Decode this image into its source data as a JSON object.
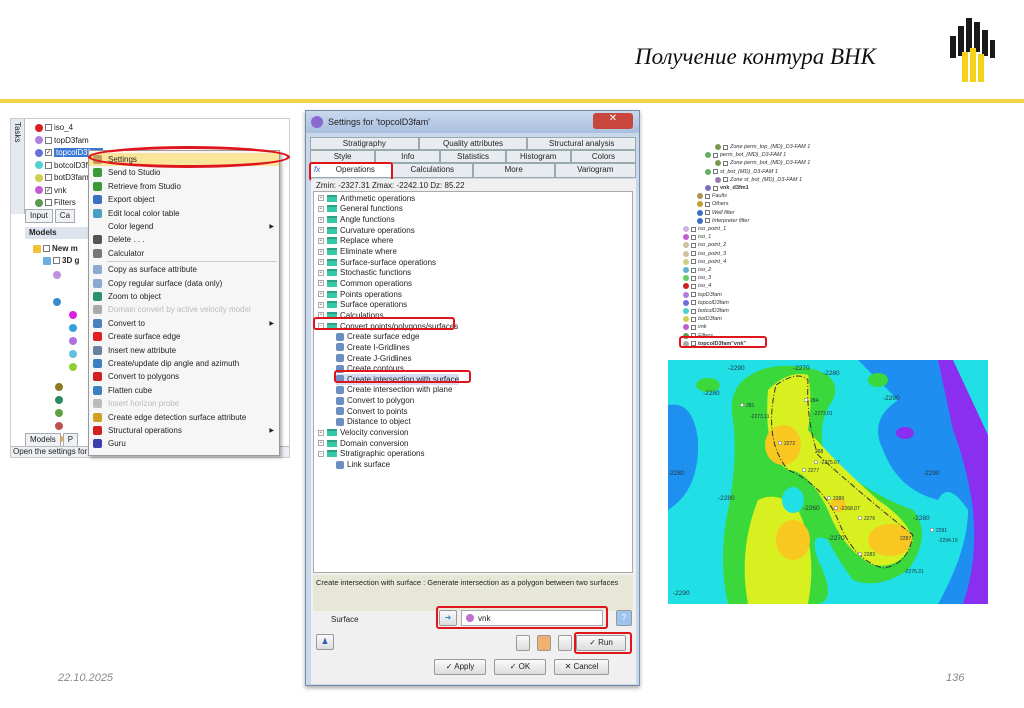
{
  "slide": {
    "title": "Получение контура ВНК",
    "date": "22.10.2025",
    "page": "136",
    "accent_color": "#f3d34a"
  },
  "left_panel": {
    "side_tabs": [
      "Tasks"
    ],
    "tree_top": [
      {
        "label": "iso_4",
        "checked": false
      },
      {
        "label": "topD3fam",
        "checked": false
      },
      {
        "label": "topcolD3fam",
        "checked": true,
        "selected": true
      },
      {
        "label": "botcolD3fam",
        "checked": false
      },
      {
        "label": "botD3fam",
        "checked": false
      },
      {
        "label": "vnk",
        "checked": true
      },
      {
        "label": "Filters",
        "checked": false
      }
    ],
    "tabs": [
      "Input",
      "Ca"
    ],
    "models_header": "Models",
    "tree_models": [
      "New m",
      "3D g"
    ],
    "bottom_tabs": [
      "Models",
      "P"
    ],
    "status": "Open the settings for t"
  },
  "context_menu": {
    "items": [
      {
        "label": "Settings",
        "highlighted": true
      },
      {
        "label": "Send to Studio"
      },
      {
        "label": "Retrieve from Studio"
      },
      {
        "label": "Export object"
      },
      {
        "label": "Edit local color table"
      },
      {
        "label": "Color legend",
        "submenu": true
      },
      {
        "label": "Delete . . ."
      },
      {
        "label": "Calculator"
      },
      {
        "label": "Copy as surface attribute"
      },
      {
        "label": "Copy regular surface (data only)"
      },
      {
        "label": "Zoom to object"
      },
      {
        "label": "Domain convert by active velocity model",
        "disabled": true
      },
      {
        "label": "Convert to",
        "submenu": true
      },
      {
        "label": "Create surface edge"
      },
      {
        "label": "Insert new attribute"
      },
      {
        "label": "Create/update dip angle and azimuth"
      },
      {
        "label": "Convert to polygons"
      },
      {
        "label": "Flatten cube"
      },
      {
        "label": "Insert horizon probe",
        "disabled": true
      },
      {
        "label": "Create edge detection surface attribute"
      },
      {
        "label": "Structural operations",
        "submenu": true
      },
      {
        "label": "Guru"
      }
    ]
  },
  "dialog": {
    "title": "Settings for 'topcolD3fam'",
    "close": "✕",
    "tabs_row1": [
      "Stratigraphy",
      "Quality attributes",
      "Structural analysis"
    ],
    "tabs_row2": [
      "Style",
      "Info",
      "Statistics",
      "Histogram",
      "Colors"
    ],
    "tabs_row3": [
      "Operations",
      "Calculations",
      "More",
      "Variogram"
    ],
    "zinfo": "Zmin: -2327.31   Zmax: -2242.10   Dz: 85.22",
    "operations": [
      {
        "label": "Arithmetic operations",
        "type": "folder"
      },
      {
        "label": "General functions",
        "type": "folder"
      },
      {
        "label": "Angle functions",
        "type": "folder"
      },
      {
        "label": "Curvature operations",
        "type": "folder"
      },
      {
        "label": "Replace where",
        "type": "folder"
      },
      {
        "label": "Eliminate where",
        "type": "folder"
      },
      {
        "label": "Surface-surface operations",
        "type": "folder"
      },
      {
        "label": "Stochastic functions",
        "type": "folder"
      },
      {
        "label": "Common operations",
        "type": "folder"
      },
      {
        "label": "Points operations",
        "type": "folder"
      },
      {
        "label": "Surface operations",
        "type": "folder"
      },
      {
        "label": "Calculations",
        "type": "folder"
      },
      {
        "label": "Convert points/polygons/surfaces",
        "type": "folder",
        "expanded": true
      },
      {
        "label": "Create surface edge",
        "type": "item"
      },
      {
        "label": "Create I-Gridlines",
        "type": "item"
      },
      {
        "label": "Create J-Gridlines",
        "type": "item"
      },
      {
        "label": "Create contours",
        "type": "item"
      },
      {
        "label": "Create intersection with surface",
        "type": "item",
        "selected": true
      },
      {
        "label": "Create intersection with plane",
        "type": "item"
      },
      {
        "label": "Convert to polygon",
        "type": "item"
      },
      {
        "label": "Convert to points",
        "type": "item"
      },
      {
        "label": "Distance to object",
        "type": "item"
      },
      {
        "label": "Velocity conversion",
        "type": "folder"
      },
      {
        "label": "Domain conversion",
        "type": "folder"
      },
      {
        "label": "Stratigraphic operations",
        "type": "folder",
        "expanded": true
      },
      {
        "label": "Link surface",
        "type": "item"
      }
    ],
    "description": "Create intersection with surface : Generate intersection as a polygon between two surfaces",
    "surface_label": "Surface",
    "surface_value": "vnk",
    "help": "?",
    "run": "✓ Run",
    "apply": "✓ Apply",
    "ok": "✓ OK",
    "cancel": "✕ Cancel"
  },
  "right_tree": [
    {
      "label": "Zone perm_top_(MD)_D3-FAM 1",
      "indent": 2,
      "chk": false
    },
    {
      "label": "perm_bot_(MD)_D3-FAM 1",
      "indent": 1,
      "chk": true
    },
    {
      "label": "Zone perm_bot_(MD)_D3-FAM 1",
      "indent": 2,
      "chk": false
    },
    {
      "label": "st_bot_(MD)_D3-FAM 1",
      "indent": 1,
      "chk": true
    },
    {
      "label": "Zone st_bot_(MD)_D3-FAM 1",
      "indent": 2,
      "chk": false
    },
    {
      "label": "vnk_d3fm1",
      "indent": 1,
      "chk": true,
      "bold": true
    },
    {
      "label": "Faults",
      "indent": 0,
      "chk": false
    },
    {
      "label": "Others",
      "indent": 0,
      "chk": true
    },
    {
      "label": "Well filter",
      "indent": 0,
      "chk": true
    },
    {
      "label": "Interpreter filter",
      "indent": 0,
      "chk": true
    },
    {
      "label": "iso_point_1",
      "indent": -1,
      "chk": true
    },
    {
      "label": "iso_1",
      "indent": -1,
      "chk": true
    },
    {
      "label": "iso_point_2",
      "indent": -1,
      "chk": true
    },
    {
      "label": "iso_point_3",
      "indent": -1,
      "chk": true
    },
    {
      "label": "iso_point_4",
      "indent": -1,
      "chk": true
    },
    {
      "label": "iso_2",
      "indent": -1,
      "chk": true
    },
    {
      "label": "iso_3",
      "indent": -1,
      "chk": true
    },
    {
      "label": "iso_4",
      "indent": -1,
      "chk": true
    },
    {
      "label": "topD3fam",
      "indent": -1,
      "chk": true
    },
    {
      "label": "topcolD3fam",
      "indent": -1,
      "chk": true
    },
    {
      "label": "botcolD3fam",
      "indent": -1,
      "chk": true
    },
    {
      "label": "botD3fam",
      "indent": -1,
      "chk": true
    },
    {
      "label": "vnk",
      "indent": -1,
      "chk": true
    },
    {
      "label": "Filters",
      "indent": -1,
      "chk": true
    },
    {
      "label": "topcolD3fam\"vnk\"",
      "indent": -1,
      "chk": true,
      "bold": true
    }
  ],
  "map": {
    "contour_labels": [
      "-2290",
      "-2280",
      "-2270",
      "-2280",
      "-2290",
      "-2280",
      "-2260",
      "-2280",
      "-2290",
      "-2280",
      "-2270",
      "-2290"
    ],
    "well_labels": [
      "281",
      "-2273.11",
      "284",
      "-2273.01",
      "2272",
      "288",
      "-2275.67",
      "2277",
      "2289",
      "-2268.07",
      "2276",
      "2287",
      "2283",
      "-2276.31",
      "2291",
      "-2294.15"
    ]
  }
}
